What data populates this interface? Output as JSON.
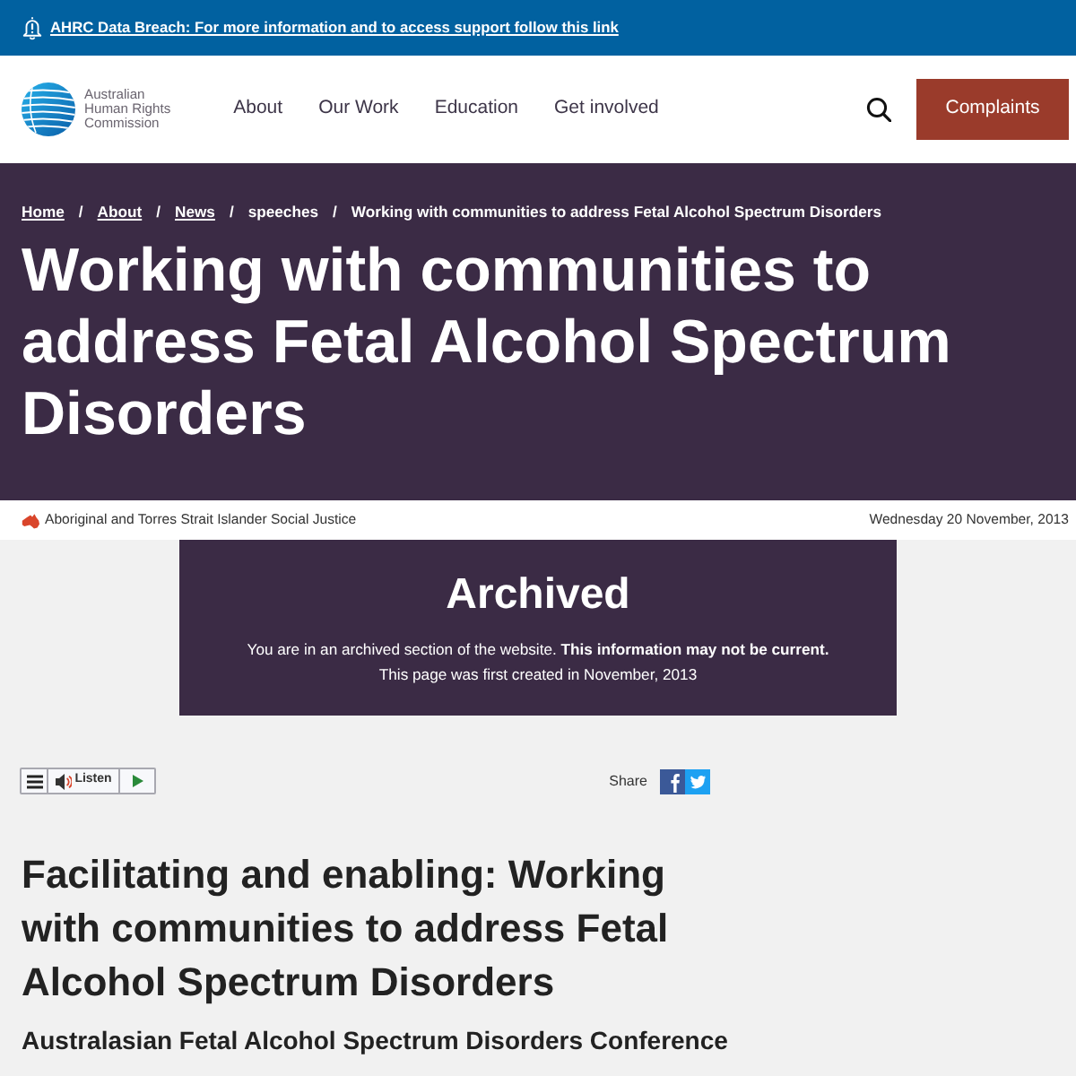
{
  "alert": {
    "text": "AHRC Data Breach: For more information and to access support follow this link"
  },
  "header": {
    "logo_lines": [
      "Australian",
      "Human Rights",
      "Commission"
    ],
    "nav": [
      "About",
      "Our Work",
      "Education",
      "Get involved"
    ],
    "button": "Complaints"
  },
  "hero": {
    "breadcrumb": [
      {
        "kind": "link",
        "label": "Home"
      },
      {
        "kind": "separator",
        "label": "/"
      },
      {
        "kind": "link",
        "label": "About"
      },
      {
        "kind": "separator",
        "label": "/"
      },
      {
        "kind": "link",
        "label": "News"
      },
      {
        "kind": "separator",
        "label": "/"
      },
      {
        "kind": "text",
        "label": "speeches"
      },
      {
        "kind": "separator",
        "label": "/"
      },
      {
        "kind": "text",
        "label": "Working with communities to address Fetal Alcohol Spectrum Disorders"
      }
    ],
    "title": "Working with communities to address Fetal Alcohol Spectrum Disorders"
  },
  "meta": {
    "topic": "Aboriginal and Torres Strait Islander Social Justice",
    "date": "Wednesday 20 November, 2013"
  },
  "archived": {
    "title": "Archived",
    "message": "You are in an archived section of the website. **This information may not be current.**",
    "created": "This page was first created in November, 2013"
  },
  "audio_player": {
    "label": "Listen"
  },
  "share": {
    "label": "Share"
  },
  "article": {
    "title": "Facilitating and enabling: Working with communities to address Fetal Alcohol Spectrum Disorders",
    "subtitle": "Australasian Fetal Alcohol Spectrum Disorders Conference"
  }
}
